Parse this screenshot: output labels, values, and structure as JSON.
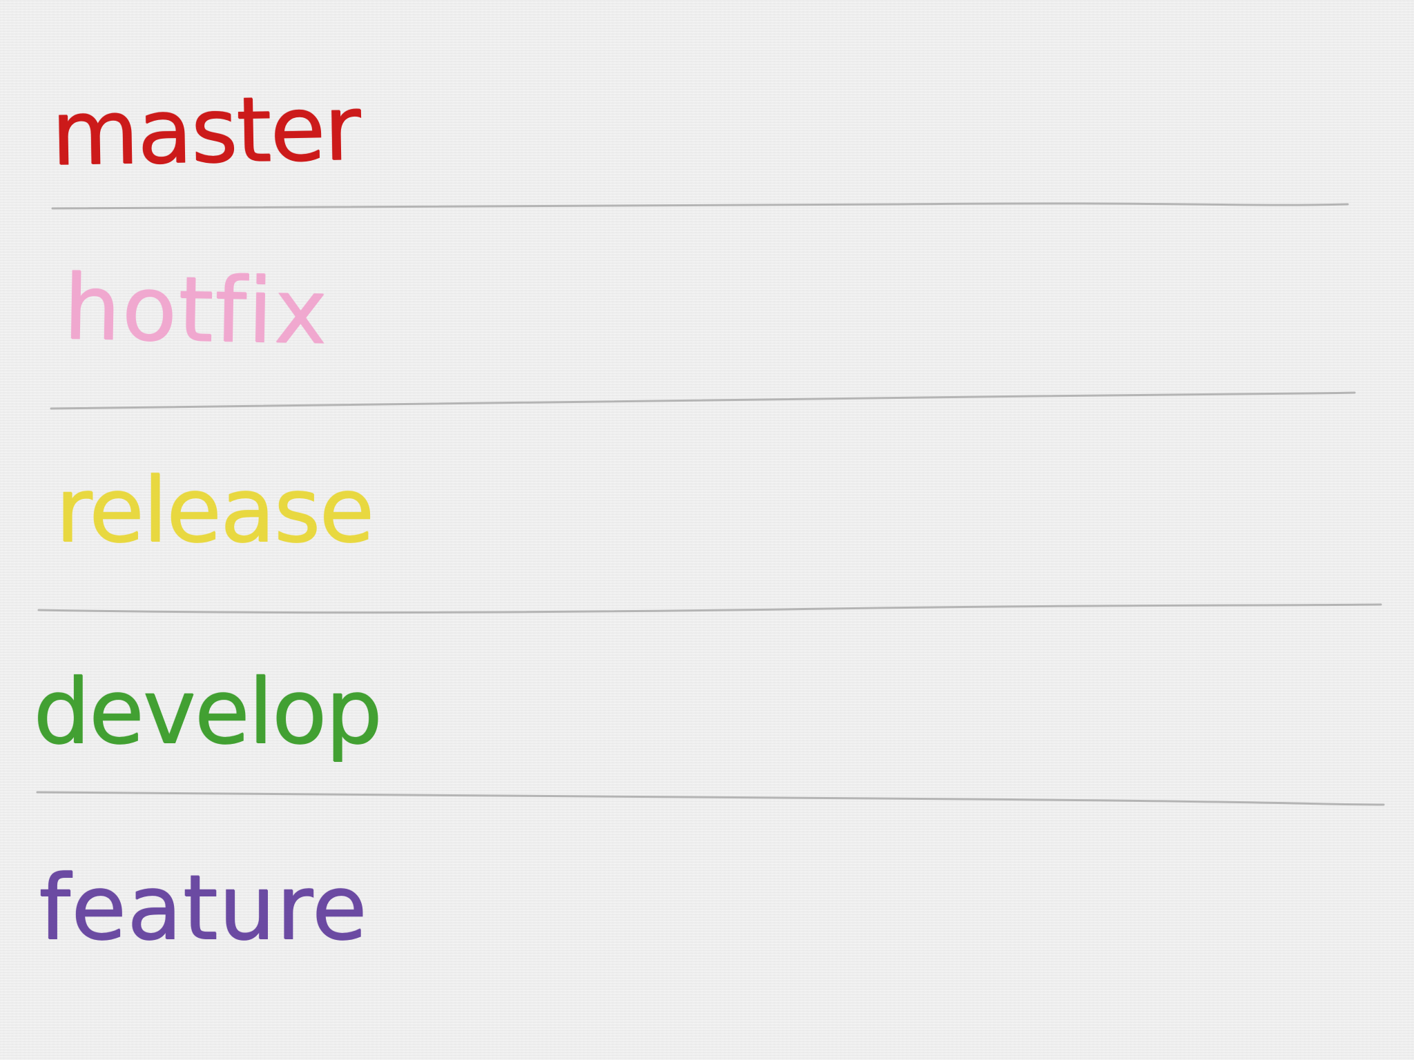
{
  "lanes": [
    {
      "label": "master",
      "color": "#cc1a1a"
    },
    {
      "label": "hotfix",
      "color": "#f0a8cf"
    },
    {
      "label": "release",
      "color": "#e8d840"
    },
    {
      "label": "develop",
      "color": "#42a032"
    },
    {
      "label": "feature",
      "color": "#6b4aa2"
    }
  ],
  "divider_color": "#a9a9a9",
  "background_color": "#eeeeee"
}
